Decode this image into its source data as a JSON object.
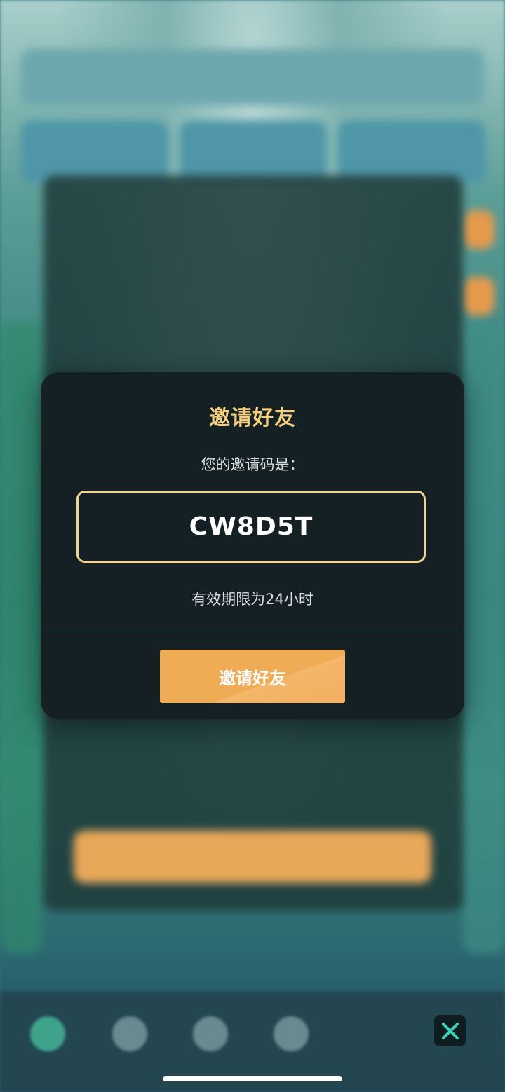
{
  "dialog": {
    "title": "邀请好友",
    "code_label": "您的邀请码是：",
    "code": "CW8D5T",
    "validity": "有效期限为24小时",
    "button_label": "邀请好友"
  },
  "colors": {
    "title": "#f4cf7e",
    "code_border": "#f2d48d",
    "button": "#f0ac55",
    "close_icon": "#36d3b6"
  },
  "icons": {
    "close": "close-icon"
  }
}
